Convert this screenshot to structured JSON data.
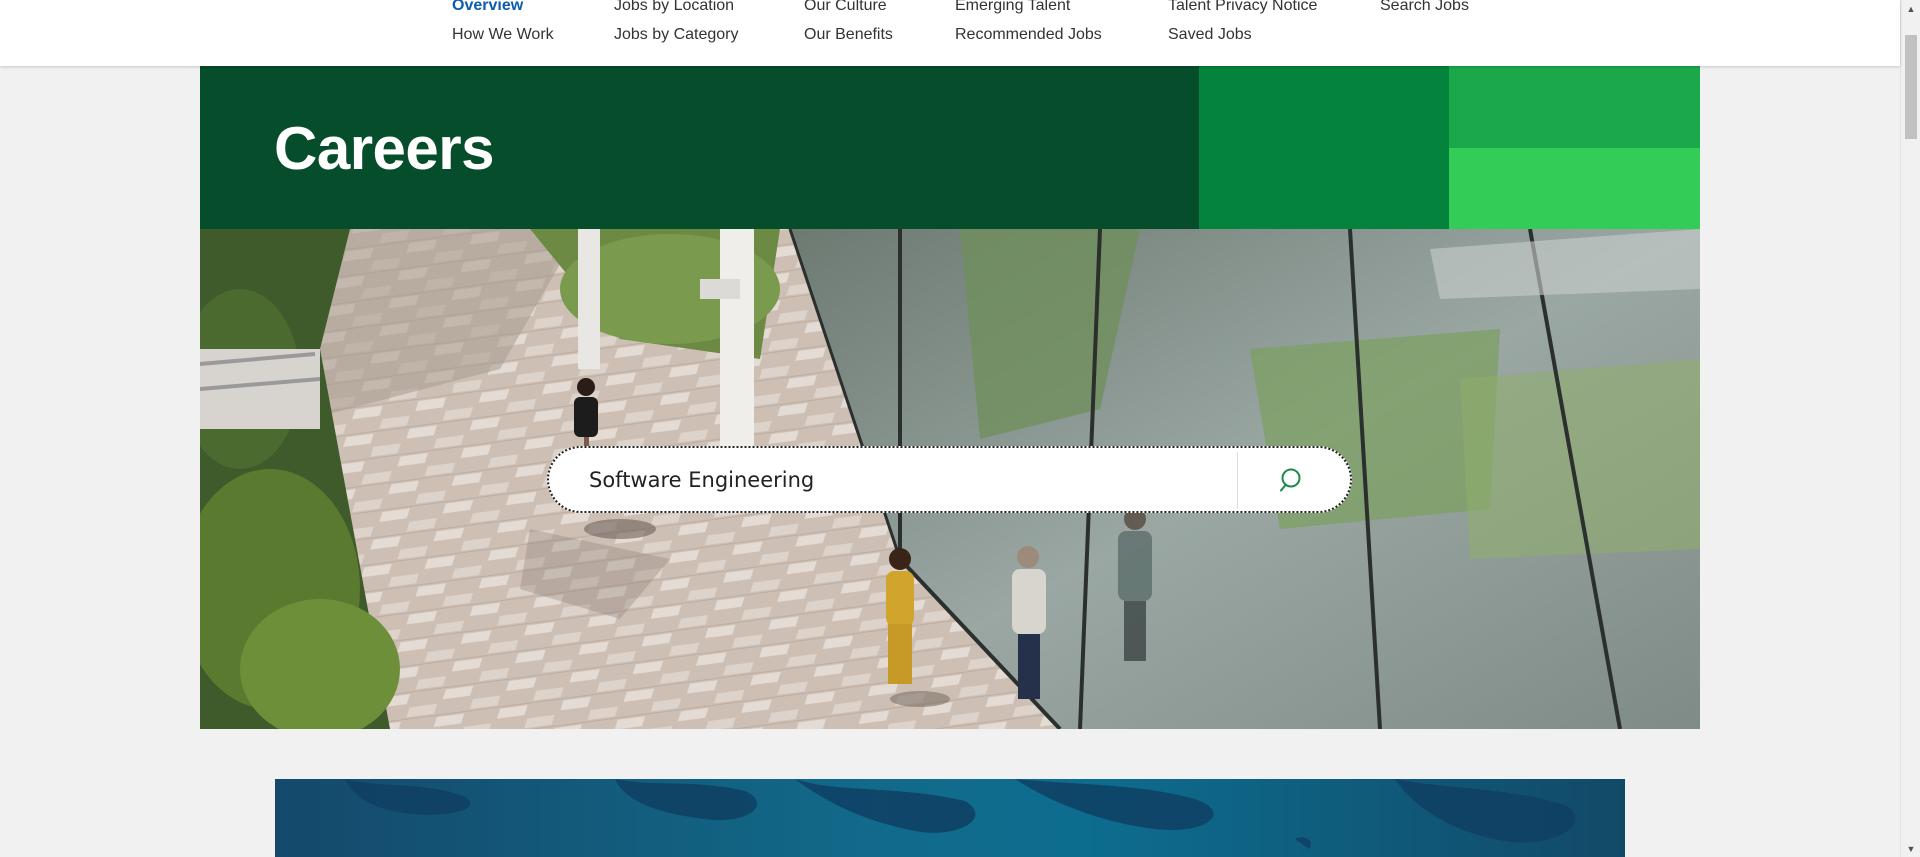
{
  "nav": {
    "row1": [
      "Overview",
      "Jobs by Location",
      "Our Culture",
      "Emerging Talent",
      "Talent Privacy Notice",
      "Search Jobs"
    ],
    "row2": [
      "How We Work",
      "Jobs by Category",
      "Our Benefits",
      "Recommended Jobs",
      "Saved Jobs"
    ],
    "active_item": "Overview"
  },
  "hero": {
    "title": "Careers",
    "colors": {
      "main": "#054d2b",
      "block1": "#04833c",
      "block2": "#1aa84a",
      "block3": "#33cc57"
    }
  },
  "search": {
    "value": "Software Engineering",
    "icon": "search-icon"
  },
  "photo": {
    "description_icon": "office-courtyard-photo"
  },
  "scrollbar": {
    "up_icon": "scroll-up-icon",
    "down_icon": "scroll-down-icon"
  }
}
